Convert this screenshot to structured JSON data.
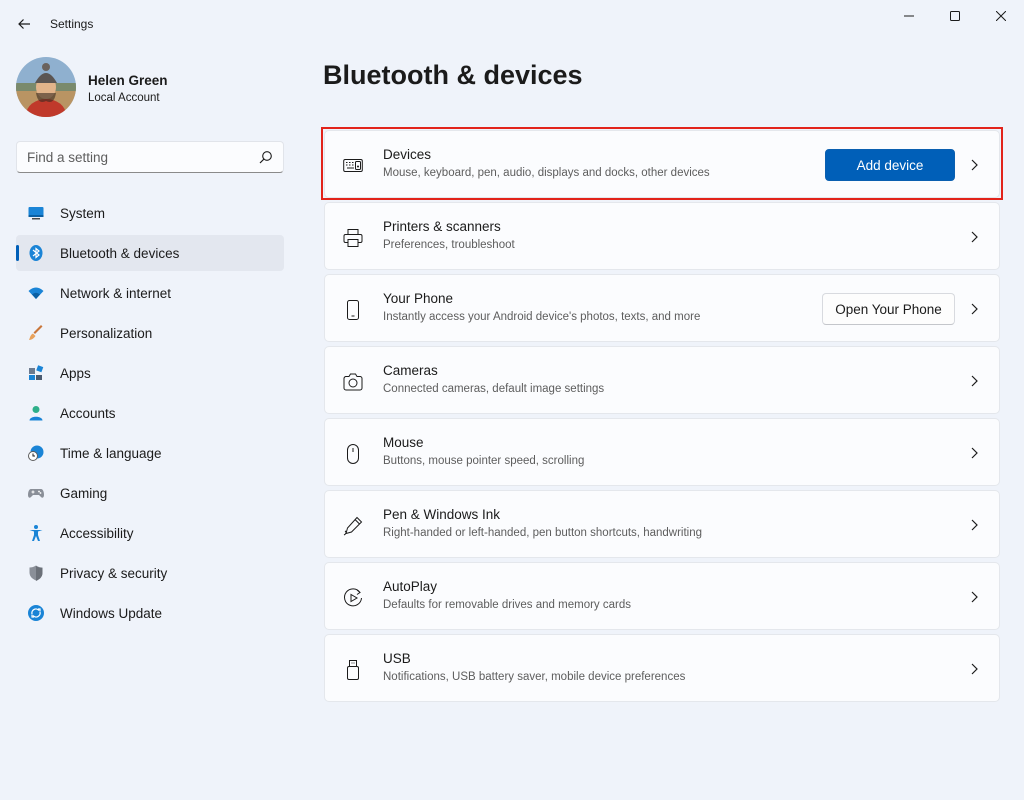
{
  "titlebar": {
    "title": "Settings"
  },
  "profile": {
    "name": "Helen Green",
    "account_type": "Local Account"
  },
  "search": {
    "placeholder": "Find a setting"
  },
  "nav": {
    "items": [
      {
        "label": "System",
        "icon": "monitor-icon"
      },
      {
        "label": "Bluetooth & devices",
        "icon": "bluetooth-icon",
        "active": true
      },
      {
        "label": "Network & internet",
        "icon": "wifi-icon"
      },
      {
        "label": "Personalization",
        "icon": "brush-icon"
      },
      {
        "label": "Apps",
        "icon": "apps-icon"
      },
      {
        "label": "Accounts",
        "icon": "person-icon"
      },
      {
        "label": "Time & language",
        "icon": "globe-clock-icon"
      },
      {
        "label": "Gaming",
        "icon": "gamepad-icon"
      },
      {
        "label": "Accessibility",
        "icon": "accessibility-icon"
      },
      {
        "label": "Privacy & security",
        "icon": "shield-icon"
      },
      {
        "label": "Windows Update",
        "icon": "update-icon"
      }
    ]
  },
  "main": {
    "title": "Bluetooth & devices",
    "cards": [
      {
        "title": "Devices",
        "subtitle": "Mouse, keyboard, pen, audio, displays and docks, other devices",
        "icon": "devices-icon",
        "button": "Add device"
      },
      {
        "title": "Printers & scanners",
        "subtitle": "Preferences, troubleshoot",
        "icon": "printer-icon"
      },
      {
        "title": "Your Phone",
        "subtitle": "Instantly access your Android device's photos, texts, and more",
        "icon": "phone-icon",
        "button": "Open Your Phone"
      },
      {
        "title": "Cameras",
        "subtitle": "Connected cameras, default image settings",
        "icon": "camera-icon"
      },
      {
        "title": "Mouse",
        "subtitle": "Buttons, mouse pointer speed, scrolling",
        "icon": "mouse-icon"
      },
      {
        "title": "Pen & Windows Ink",
        "subtitle": "Right-handed or left-handed, pen button shortcuts, handwriting",
        "icon": "pen-icon"
      },
      {
        "title": "AutoPlay",
        "subtitle": "Defaults for removable drives and memory cards",
        "icon": "autoplay-icon"
      },
      {
        "title": "USB",
        "subtitle": "Notifications, USB battery saver, mobile device preferences",
        "icon": "usb-icon"
      }
    ]
  },
  "colors": {
    "accent": "#005fb8",
    "highlight": "#e2231a",
    "background": "#eff3fa"
  }
}
